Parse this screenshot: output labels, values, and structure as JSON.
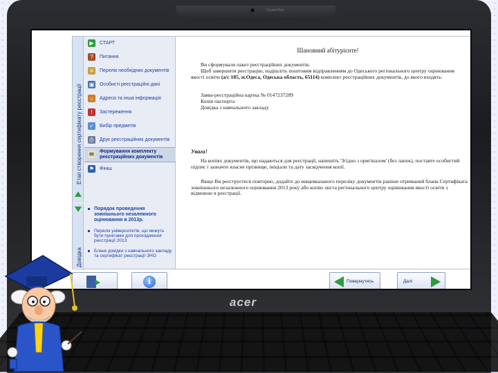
{
  "laptop": {
    "camera_label": "Crystal Eye",
    "brand": "acer"
  },
  "sidebar": {
    "vertical_tab_main": "Етап створення сертифікату реєстрації",
    "vertical_tab_info": "Довідка",
    "items": [
      {
        "label": "СТАРТ",
        "icon": "play-icon"
      },
      {
        "label": "Питання",
        "icon": "questions-icon"
      },
      {
        "label": "Перелік необхідних документів",
        "icon": "documents-icon"
      },
      {
        "label": "Особисті реєстраційні дані",
        "icon": "personal-data-icon"
      },
      {
        "label": "Адреса та інша інформація",
        "icon": "address-icon"
      },
      {
        "label": "Застереження",
        "icon": "warning-icon"
      },
      {
        "label": "Вибір предметів",
        "icon": "subjects-icon"
      },
      {
        "label": "Друк реєстраційних документів",
        "icon": "print-icon"
      },
      {
        "label": "Формування комплекту реєстраційних документів",
        "icon": "envelope-icon"
      },
      {
        "label": "Фініш",
        "icon": "finish-icon"
      }
    ],
    "info_links": [
      "Порядок проведення зовнішнього незалежного оцінювання в 2013р.",
      "Перелік університетів, що можуть бути пунктами для проходження реєстрації 2013",
      "Бланк довідки з навчального закладу та сертифікат реєстрації ЗНО"
    ]
  },
  "content": {
    "title": "Шановний абітурієнте!",
    "p1": "Ви сформували пакет реєстраційних документів.",
    "p2_pre": "Щоб завершити реєстрацію, надішліть поштовим відправленням до Одеського регіонального центру оцінювання якості освіти ",
    "p2_bold": "(а/с 185, м.Одеса, Одеська область, 65114)",
    "p2_post": " комплект реєстраційних документів, до якого входять:",
    "docs": [
      "Заява-реєстраційна картка № 0147237289",
      "Копія паспорта",
      "Довідка з навчального закладу"
    ],
    "warning_title": "Увага!",
    "p3": "На копіях документів, що надаються для реєстрації, напишіть 'Згідно з оригіналом' (без лапок), поставте особистий підпис і зазначте власне прізвище, ініціали та дату засвідчення копії.",
    "p4": "Якщо Ви реєструєтеся повторно, додайте до вищевказаного переліку документів раніше отриманий бланк Сертифіката зовнішнього незалежного оцінювання 2013 року або копію листа регіонального центру оцінювання якості освіти з відмовою в реєстрації."
  },
  "toolbar": {
    "back_label": "Повернутись",
    "next_label": "Далі"
  },
  "colors": {
    "accent_green": "#2e9c3b",
    "link_blue": "#1d3ea8"
  }
}
